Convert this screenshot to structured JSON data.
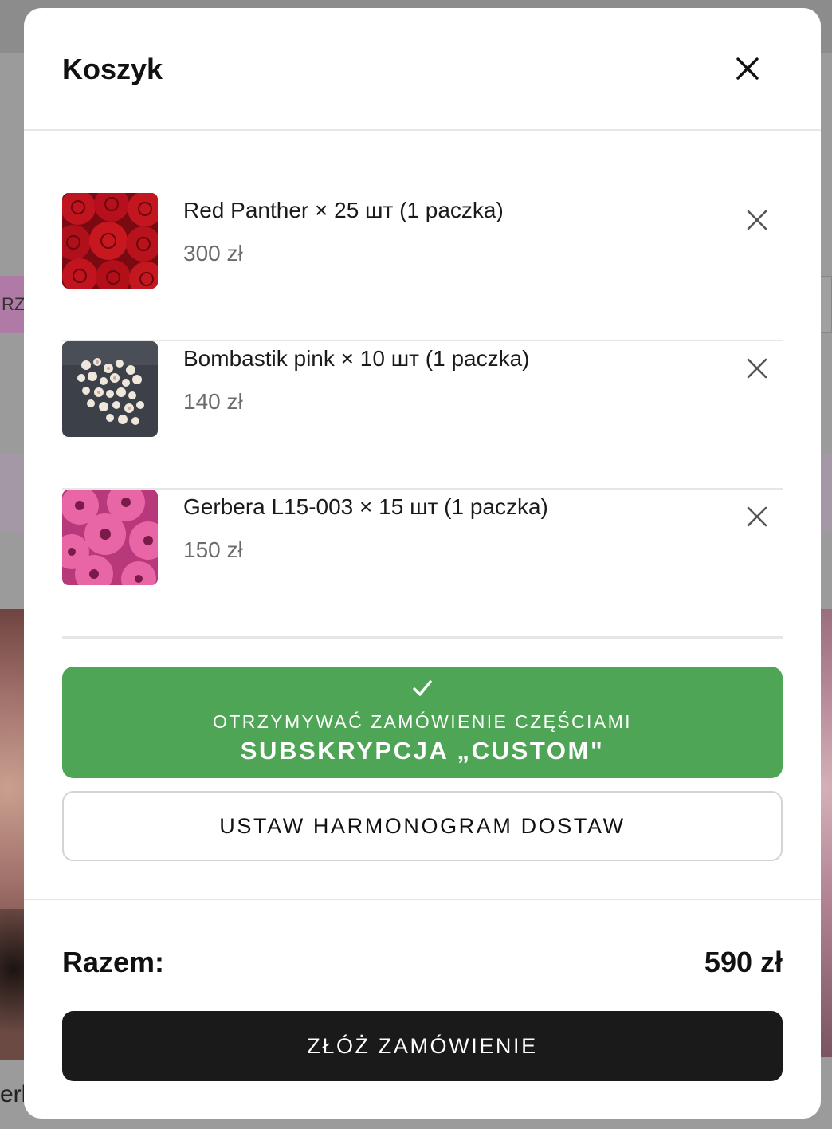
{
  "background": {
    "left_pill_text": "RZ",
    "bottom_text": "erb"
  },
  "cart": {
    "title": "Koszyk",
    "items": [
      {
        "name": "Red Panther × 25 шт (1 paczka)",
        "price": "300 zł",
        "image": "red-roses"
      },
      {
        "name": "Bombastik pink × 10 шт (1 paczka)",
        "price": "140 zł",
        "image": "white-spray-roses"
      },
      {
        "name": "Gerbera L15-003 × 15 шт (1 paczka)",
        "price": "150 zł",
        "image": "pink-gerberas"
      }
    ],
    "subscription": {
      "line1": "OTRZYMYWAĆ ZAMÓWIENIE CZĘŚCIAMI",
      "line2": "SUBSKRYPCJA „CUSTOM\"",
      "checked": true
    },
    "schedule_label": "USTAW HARMONOGRAM DOSTAW",
    "total_label": "Razem:",
    "total_value": "590 zł",
    "order_label": "ZŁÓŻ ZAMÓWIENIE"
  },
  "colors": {
    "subscription_bg": "#4fa556",
    "order_bg": "#1a1a1a",
    "overlay_bg": "#8a8a8a"
  },
  "icons": [
    "close-icon",
    "remove-item-icon",
    "check-icon"
  ]
}
